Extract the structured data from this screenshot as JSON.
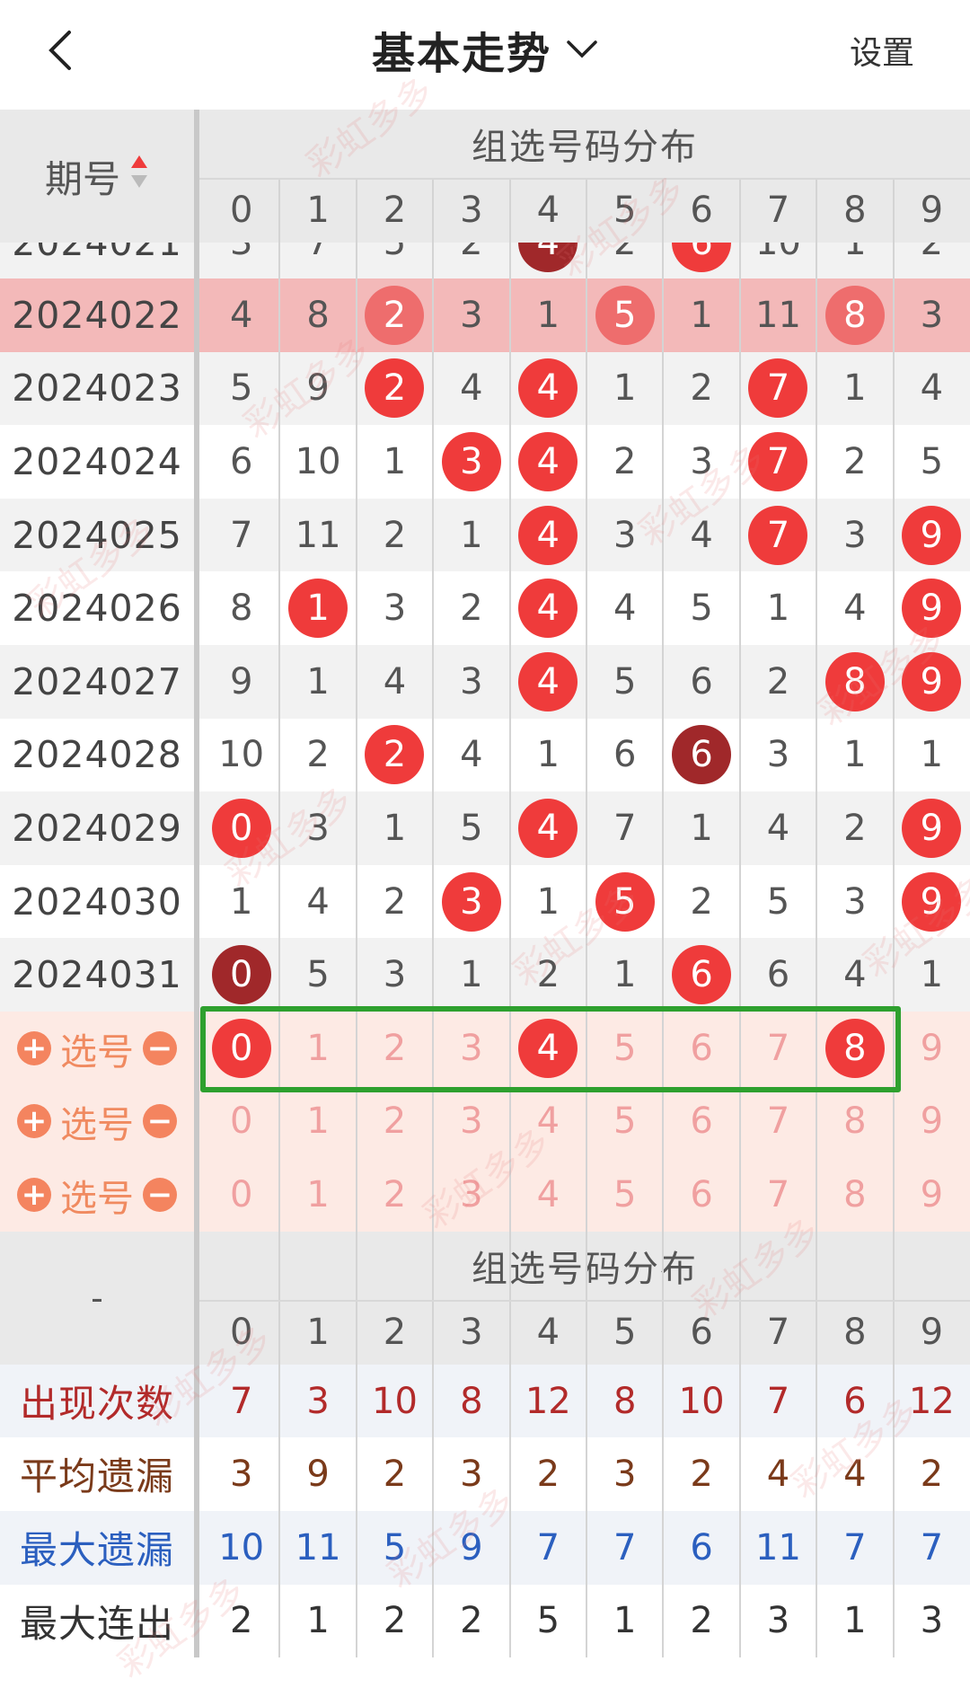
{
  "header": {
    "title": "基本走势",
    "settings_label": "设置"
  },
  "table": {
    "period_header": "期号",
    "section_title": "组选号码分布",
    "digits": [
      "0",
      "1",
      "2",
      "3",
      "4",
      "5",
      "6",
      "7",
      "8",
      "9"
    ],
    "rows": [
      {
        "period": "2024021",
        "values": [
          "3",
          "7",
          "5",
          "2",
          "4",
          "2",
          "6",
          "10",
          "1",
          "2"
        ],
        "hits": [
          4,
          6
        ],
        "dark": [
          4
        ],
        "partial": true
      },
      {
        "period": "2024022",
        "values": [
          "4",
          "8",
          "2",
          "3",
          "1",
          "5",
          "1",
          "11",
          "8",
          "3"
        ],
        "hits": [
          2,
          5,
          8
        ],
        "dark": [],
        "highlight": true
      },
      {
        "period": "2024023",
        "values": [
          "5",
          "9",
          "2",
          "4",
          "4",
          "1",
          "2",
          "7",
          "1",
          "4"
        ],
        "hits": [
          2,
          4,
          7
        ],
        "dark": []
      },
      {
        "period": "2024024",
        "values": [
          "6",
          "10",
          "1",
          "3",
          "4",
          "2",
          "3",
          "7",
          "2",
          "5"
        ],
        "hits": [
          3,
          4,
          7
        ],
        "dark": []
      },
      {
        "period": "2024025",
        "values": [
          "7",
          "11",
          "2",
          "1",
          "4",
          "3",
          "4",
          "7",
          "3",
          "9"
        ],
        "hits": [
          4,
          7,
          9
        ],
        "dark": []
      },
      {
        "period": "2024026",
        "values": [
          "8",
          "1",
          "3",
          "2",
          "4",
          "4",
          "5",
          "1",
          "4",
          "9"
        ],
        "hits": [
          1,
          4,
          9
        ],
        "dark": []
      },
      {
        "period": "2024027",
        "values": [
          "9",
          "1",
          "4",
          "3",
          "4",
          "5",
          "6",
          "2",
          "8",
          "9"
        ],
        "hits": [
          4,
          8,
          9
        ],
        "dark": []
      },
      {
        "period": "2024028",
        "values": [
          "10",
          "2",
          "2",
          "4",
          "1",
          "6",
          "6",
          "3",
          "1",
          "1"
        ],
        "hits": [
          2,
          6
        ],
        "dark": [
          6
        ]
      },
      {
        "period": "2024029",
        "values": [
          "0",
          "3",
          "1",
          "5",
          "4",
          "7",
          "1",
          "4",
          "2",
          "9"
        ],
        "hits": [
          0,
          4,
          9
        ],
        "dark": []
      },
      {
        "period": "2024030",
        "values": [
          "1",
          "4",
          "2",
          "3",
          "1",
          "5",
          "2",
          "5",
          "3",
          "9"
        ],
        "hits": [
          3,
          5,
          9
        ],
        "dark": []
      },
      {
        "period": "2024031",
        "values": [
          "0",
          "5",
          "3",
          "1",
          "2",
          "1",
          "6",
          "6",
          "4",
          "1"
        ],
        "hits": [
          0,
          6
        ],
        "dark": [
          0
        ]
      }
    ],
    "select_rows": [
      {
        "label": "选号",
        "selected": [
          0,
          4,
          8
        ]
      },
      {
        "label": "选号",
        "selected": []
      },
      {
        "label": "选号",
        "selected": []
      }
    ],
    "stats_dash": "-",
    "stats": [
      {
        "label": "出现次数",
        "values": [
          "7",
          "3",
          "10",
          "8",
          "12",
          "8",
          "10",
          "7",
          "6",
          "12"
        ],
        "color": "#b22a2a"
      },
      {
        "label": "平均遗漏",
        "values": [
          "3",
          "9",
          "2",
          "3",
          "2",
          "3",
          "2",
          "4",
          "4",
          "2"
        ],
        "color": "#7a3a1a"
      },
      {
        "label": "最大遗漏",
        "values": [
          "10",
          "11",
          "5",
          "9",
          "7",
          "7",
          "6",
          "11",
          "7",
          "7"
        ],
        "color": "#2b5fbf"
      },
      {
        "label": "最大连出",
        "values": [
          "2",
          "1",
          "2",
          "2",
          "5",
          "1",
          "2",
          "3",
          "1",
          "3"
        ],
        "color": "#333333"
      }
    ]
  },
  "watermark_text": "彩虹多多",
  "colors": {
    "ball_red": "#ef3b3b",
    "ball_dark": "#a0282a",
    "highlight_row": "#f3b9b9",
    "select_bg": "#fdeae4",
    "green_frame": "#2ea02e"
  }
}
